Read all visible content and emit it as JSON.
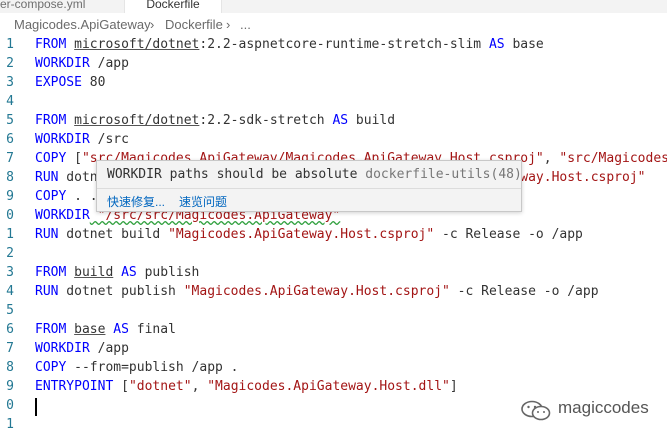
{
  "tabs": [
    {
      "label": "ker-compose.yml",
      "active": false
    },
    {
      "label": "Dockerfile",
      "active": true
    }
  ],
  "breadcrumb": [
    "Magicodes.ApiGateway",
    "›",
    "Dockerfile",
    "›",
    "..."
  ],
  "gutter": [
    "1",
    "2",
    "3",
    "4",
    "5",
    "6",
    "7",
    "8",
    "9",
    "0",
    "1",
    "2",
    "3",
    "4",
    "5",
    "6",
    "7",
    "8",
    "9",
    "0",
    "1"
  ],
  "code": [
    [
      {
        "t": "FROM ",
        "c": "kw"
      },
      {
        "t": "microsoft/dotnet",
        "c": "ul"
      },
      {
        "t": ":2.2-aspnetcore-runtime-stretch-slim "
      },
      {
        "t": "AS",
        "c": "kw"
      },
      {
        "t": " base"
      }
    ],
    [
      {
        "t": "WORKDIR",
        "c": "kw"
      },
      {
        "t": " /app"
      }
    ],
    [
      {
        "t": "EXPOSE",
        "c": "kw"
      },
      {
        "t": " 80"
      }
    ],
    [],
    [
      {
        "t": "FROM ",
        "c": "kw"
      },
      {
        "t": "microsoft/dotnet",
        "c": "ul"
      },
      {
        "t": ":2.2-sdk-stretch "
      },
      {
        "t": "AS",
        "c": "kw"
      },
      {
        "t": " build"
      }
    ],
    [
      {
        "t": "WORKDIR",
        "c": "kw"
      },
      {
        "t": " /src"
      }
    ],
    [
      {
        "t": "COPY",
        "c": "kw"
      },
      {
        "t": " ["
      },
      {
        "t": "\"src/Magicodes.ApiGateway/Magicodes.ApiGateway.Host.csproj\"",
        "c": "str"
      },
      {
        "t": ", "
      },
      {
        "t": "\"src/Magicodes.",
        "c": "str"
      }
    ],
    [
      {
        "t": "RUN",
        "c": "kw"
      },
      {
        "t": " dotnet restore "
      },
      {
        "t": "\"src/Magicodes.ApiGateway/Magicodes.ApiGateway.Host.csproj\"",
        "c": "str"
      }
    ],
    [
      {
        "t": "COPY",
        "c": "kw"
      },
      {
        "t": " . ."
      }
    ],
    [
      {
        "t": "WORKDIR",
        "c": "kw"
      },
      {
        "t": " \"/src/src/Magicodes.ApiGateway\"",
        "c": "str squig"
      }
    ],
    [
      {
        "t": "RUN",
        "c": "kw"
      },
      {
        "t": " dotnet build "
      },
      {
        "t": "\"Magicodes.ApiGateway.Host.csproj\"",
        "c": "str"
      },
      {
        "t": " -c Release -o /app"
      }
    ],
    [],
    [
      {
        "t": "FROM ",
        "c": "kw"
      },
      {
        "t": "build",
        "c": "ul"
      },
      {
        "t": " "
      },
      {
        "t": "AS",
        "c": "kw"
      },
      {
        "t": " publish"
      }
    ],
    [
      {
        "t": "RUN",
        "c": "kw"
      },
      {
        "t": " dotnet publish "
      },
      {
        "t": "\"Magicodes.ApiGateway.Host.csproj\"",
        "c": "str"
      },
      {
        "t": " -c Release -o /app"
      }
    ],
    [],
    [
      {
        "t": "FROM ",
        "c": "kw"
      },
      {
        "t": "base",
        "c": "ul"
      },
      {
        "t": " "
      },
      {
        "t": "AS",
        "c": "kw"
      },
      {
        "t": " final"
      }
    ],
    [
      {
        "t": "WORKDIR",
        "c": "kw"
      },
      {
        "t": " /app"
      }
    ],
    [
      {
        "t": "COPY",
        "c": "kw"
      },
      {
        "t": " --from=publish /app ."
      }
    ],
    [
      {
        "t": "ENTRYPOINT",
        "c": "kw"
      },
      {
        "t": " ["
      },
      {
        "t": "\"dotnet\"",
        "c": "str"
      },
      {
        "t": ", "
      },
      {
        "t": "\"Magicodes.ApiGateway.Host.dll\"",
        "c": "str"
      },
      {
        "t": "]"
      }
    ],
    [],
    []
  ],
  "hover": {
    "message": "WORKDIR paths should be absolute",
    "source": "dockerfile-utils(48)",
    "quick_fix": "快速修复...",
    "peek_problem": "速览问题"
  },
  "watermark": {
    "text": "magiccodes",
    "icon": "wechat-icon"
  },
  "colors": {
    "keyword": "#0000ff",
    "string": "#a31515",
    "line_number": "#237893",
    "link": "#0066bf"
  }
}
